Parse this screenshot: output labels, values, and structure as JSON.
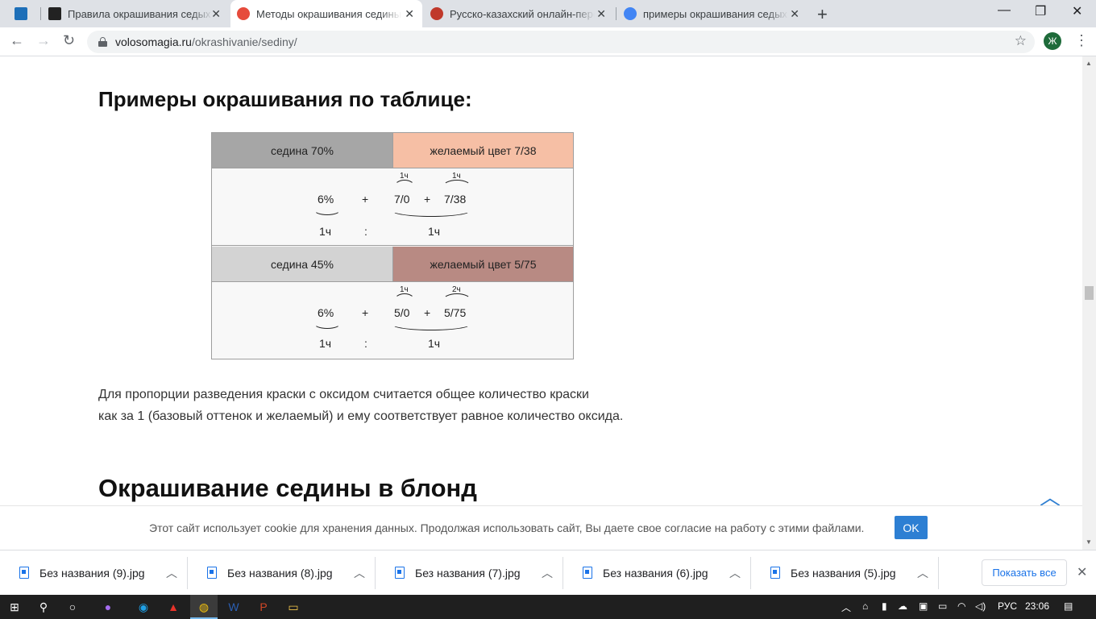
{
  "browser": {
    "tabs": [
      {
        "title": "",
        "favicon_color": "#1d6fb8"
      },
      {
        "title": "Правила окрашивания седых волос",
        "favicon_color": "#222222"
      },
      {
        "title": "Методы окрашивания седины | Волосомагия",
        "favicon_color": "#e64b3c",
        "active": true
      },
      {
        "title": "Русско-казахский онлайн-переводчик",
        "favicon_color": "#c0392b"
      },
      {
        "title": "примеры окрашивания седых волос",
        "favicon_color": "#4285f4"
      }
    ],
    "close_glyph": "✕",
    "new_tab_glyph": "+",
    "url_host": "volosomagia.ru",
    "url_path": "/okrashivanie/sediny/",
    "profile_initial": "Ж"
  },
  "article": {
    "heading": "Примеры окрашивания по таблице:",
    "table": {
      "blocks": [
        {
          "left_header": "седина 70%",
          "right_header": "желаемый цвет 7/38",
          "left_color": "#a6a6a6",
          "right_color": "#f6bfa5",
          "oxide": "6%",
          "plus1": "+",
          "shade1": "7/0",
          "plus2": "+",
          "shade2": "7/38",
          "part1": "1ч",
          "part2": "1ч",
          "ratio_left": "1ч",
          "ratio_sep": ":",
          "ratio_right": "1ч"
        },
        {
          "left_header": "седина 45%",
          "right_header": "желаемый цвет 5/75",
          "left_color": "#d3d3d3",
          "right_color": "#b88a83",
          "oxide": "6%",
          "plus1": "+",
          "shade1": "5/0",
          "plus2": "+",
          "shade2": "5/75",
          "part1": "1ч",
          "part2": "2ч",
          "ratio_left": "1ч",
          "ratio_sep": ":",
          "ratio_right": "1ч"
        }
      ]
    },
    "paragraph_line1": "Для пропорции разведения краски с оксидом считается общее количество краски",
    "paragraph_line2": "как за 1 (базовый оттенок и желаемый) и ему соответствует равное количество оксида.",
    "next_heading": "Окрашивание седины в блонд"
  },
  "cookie_bar": {
    "text": "Этот сайт использует cookie для хранения данных. Продолжая использовать сайт, Вы даете свое согласие на работу с этими файлами.",
    "ok_label": "OK"
  },
  "downloads": {
    "items": [
      {
        "name": "Без названия (9).jpg"
      },
      {
        "name": "Без названия (8).jpg"
      },
      {
        "name": "Без названия (7).jpg"
      },
      {
        "name": "Без названия (6).jpg"
      },
      {
        "name": "Без названия (5).jpg"
      }
    ],
    "show_all_label": "Показать все"
  },
  "taskbar": {
    "language": "РУС",
    "time": "23:06"
  }
}
